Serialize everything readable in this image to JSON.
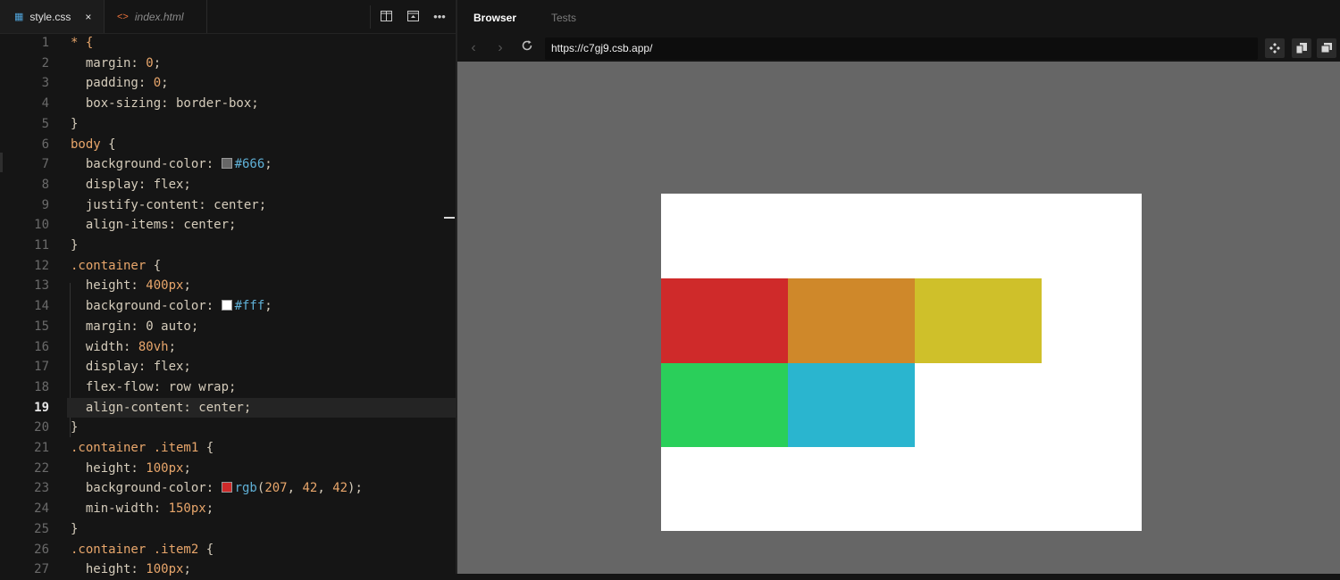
{
  "editor": {
    "tabs": [
      {
        "label": "style.css",
        "close": "×"
      },
      {
        "label": "index.html"
      }
    ],
    "lines": [
      "1",
      "2",
      "3",
      "4",
      "5",
      "6",
      "7",
      "8",
      "9",
      "10",
      "11",
      "12",
      "13",
      "14",
      "15",
      "16",
      "17",
      "18",
      "19",
      "20",
      "21",
      "22",
      "23",
      "24",
      "25",
      "26",
      "27"
    ],
    "current_line": "19",
    "code": {
      "l1": "* {",
      "l2a": "  margin: ",
      "l2b": "0",
      "l2c": ";",
      "l3a": "  padding: ",
      "l3b": "0",
      "l3c": ";",
      "l4": "  box-sizing: border-box;",
      "l5": "}",
      "l6a": "body",
      "l6b": " {",
      "l7a": "  background-color: ",
      "l7b": "#666",
      "l7c": ";",
      "l8": "  display: flex;",
      "l9": "  justify-content: center;",
      "l10": "  align-items: center;",
      "l11": "}",
      "l12a": ".container",
      "l12b": " {",
      "l13a": "  height: ",
      "l13b": "400px",
      "l13c": ";",
      "l14a": "  background-color: ",
      "l14b": "#fff",
      "l14c": ";",
      "l15": "  margin: 0 auto;",
      "l16a": "  width: ",
      "l16b": "80vh",
      "l16c": ";",
      "l17": "  display: flex;",
      "l18": "  flex-flow: row wrap;",
      "l19": "  align-content: center;",
      "l20": "}",
      "l21a": ".container .item1",
      "l21b": " {",
      "l22a": "  height: ",
      "l22b": "100px",
      "l22c": ";",
      "l23a": "  background-color: ",
      "l23b": "rgb",
      "l23c": "(",
      "l23d": "207",
      "l23e": ", ",
      "l23f": "42",
      "l23g": ", ",
      "l23h": "42",
      "l23i": ");",
      "l24a": "  min-width: ",
      "l24b": "150px",
      "l24c": ";",
      "l25": "}",
      "l26a": ".container .item2",
      "l26b": " {",
      "l27a": "  height: ",
      "l27b": "100px",
      "l27c": ";"
    },
    "swatches": {
      "gray": "#666666",
      "white": "#ffffff",
      "red": "#cf2a2a"
    }
  },
  "preview": {
    "tabs": {
      "browser": "Browser",
      "tests": "Tests"
    },
    "url": "https://c7gj9.csb.app/",
    "page_background": "#666666",
    "container_background": "#ffffff",
    "items": [
      {
        "name": "item1",
        "color": "#cf2a2a"
      },
      {
        "name": "item2",
        "color": "#cf882a"
      },
      {
        "name": "item3",
        "color": "#cfc02a"
      },
      {
        "name": "item4",
        "color": "#2acf5a"
      },
      {
        "name": "item5",
        "color": "#2ab5cf"
      }
    ]
  }
}
